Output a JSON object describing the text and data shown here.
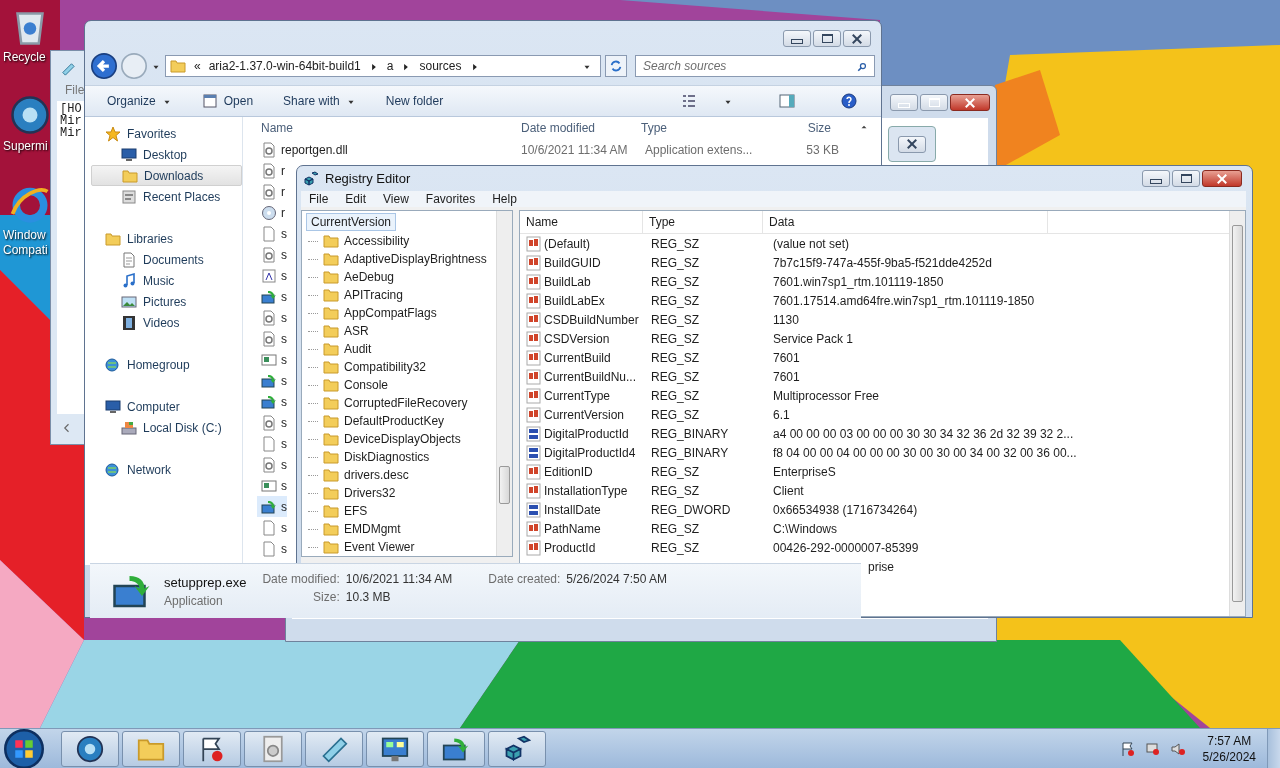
{
  "desktop_icons": [
    {
      "label": "Recycle"
    },
    {
      "label": "Supermi"
    },
    {
      "label": "Window\nCompati"
    }
  ],
  "notepad": {
    "menu": "File",
    "lines": [
      "[HO",
      "Mir",
      "Mir"
    ]
  },
  "explorer": {
    "path": [
      "aria2-1.37.0-win-64bit-build1",
      "a",
      "sources"
    ],
    "overflow": "«",
    "search": {
      "placeholder": "Search sources"
    },
    "toolbar": [
      {
        "label": "Organize",
        "kind": "menu"
      },
      {
        "label": "Open",
        "kind": "open"
      },
      {
        "label": "Share with",
        "kind": "menu"
      },
      {
        "label": "New folder",
        "kind": "plain"
      }
    ],
    "nav": [
      {
        "label": "Favorites",
        "selected": false,
        "children": [
          {
            "label": "Desktop",
            "selected": false
          },
          {
            "label": "Downloads",
            "selected": true
          },
          {
            "label": "Recent Places",
            "selected": false
          }
        ]
      },
      {
        "label": "Libraries",
        "selected": false,
        "children": [
          {
            "label": "Documents",
            "selected": false
          },
          {
            "label": "Music",
            "selected": false
          },
          {
            "label": "Pictures",
            "selected": false
          },
          {
            "label": "Videos",
            "selected": false
          }
        ]
      },
      {
        "label": "Homegroup",
        "selected": false
      },
      {
        "label": "Computer",
        "selected": false,
        "children": [
          {
            "label": "Local Disk (C:)",
            "selected": false
          }
        ]
      },
      {
        "label": "Network",
        "selected": false
      }
    ],
    "columns": [
      "Name",
      "Date modified",
      "Type",
      "Size"
    ],
    "files": [
      {
        "name": "reportgen.dll",
        "date": "10/6/2021 11:34 AM",
        "type": "Application extens...",
        "size": "53 KB",
        "kind": "dll",
        "selected": false
      },
      {
        "name": "r",
        "kind": "dll",
        "selected": false
      },
      {
        "name": "r",
        "kind": "dll",
        "selected": false
      },
      {
        "name": "r",
        "kind": "cd",
        "selected": false
      },
      {
        "name": "s",
        "kind": "blank",
        "selected": false
      },
      {
        "name": "s",
        "kind": "dll",
        "selected": false
      },
      {
        "name": "s",
        "kind": "font",
        "selected": false
      },
      {
        "name": "s",
        "kind": "setup",
        "selected": false
      },
      {
        "name": "s",
        "kind": "dll",
        "selected": false
      },
      {
        "name": "s",
        "kind": "dll",
        "selected": false
      },
      {
        "name": "s",
        "kind": "img",
        "selected": false
      },
      {
        "name": "s",
        "kind": "setup",
        "selected": false
      },
      {
        "name": "s",
        "kind": "setup",
        "selected": false
      },
      {
        "name": "s",
        "kind": "dll",
        "selected": false
      },
      {
        "name": "s",
        "kind": "blank",
        "selected": false
      },
      {
        "name": "s",
        "kind": "dll",
        "selected": false
      },
      {
        "name": "s",
        "kind": "img",
        "selected": false
      },
      {
        "name": "s",
        "kind": "setup",
        "selected": true
      },
      {
        "name": "s",
        "kind": "blank",
        "selected": false
      },
      {
        "name": "s",
        "kind": "blank",
        "selected": false
      }
    ],
    "details": {
      "name": "setupprep.exe",
      "type": "Application",
      "fields": [
        {
          "label": "Date modified:",
          "value": "10/6/2021 11:34 AM"
        },
        {
          "label": "Size:",
          "value": "10.3 MB"
        },
        {
          "label": "Date created:",
          "value": "5/26/2024 7:50 AM"
        }
      ]
    }
  },
  "registry": {
    "title": "Registry Editor",
    "menu": [
      "File",
      "Edit",
      "View",
      "Favorites",
      "Help"
    ],
    "tree": {
      "label": "CurrentVersion",
      "selected": true,
      "children": [
        "Accessibility",
        "AdaptiveDisplayBrightness",
        "AeDebug",
        "APITracing",
        "AppCompatFlags",
        "ASR",
        "Audit",
        "Compatibility32",
        "Console",
        "CorruptedFileRecovery",
        "DefaultProductKey",
        "DeviceDisplayObjects",
        "DiskDiagnostics",
        "drivers.desc",
        "Drivers32",
        "EFS",
        "EMDMgmt",
        "Event Viewer"
      ]
    },
    "columns": [
      "Name",
      "Type",
      "Data"
    ],
    "values": [
      {
        "kind": "string",
        "name": "(Default)",
        "type": "REG_SZ",
        "data": "(value not set)"
      },
      {
        "kind": "string",
        "name": "BuildGUID",
        "type": "REG_SZ",
        "data": "7b7c15f9-747a-455f-9ba5-f521dde4252d"
      },
      {
        "kind": "string",
        "name": "BuildLab",
        "type": "REG_SZ",
        "data": "7601.win7sp1_rtm.101119-1850"
      },
      {
        "kind": "string",
        "name": "BuildLabEx",
        "type": "REG_SZ",
        "data": "7601.17514.amd64fre.win7sp1_rtm.101119-1850"
      },
      {
        "kind": "string",
        "name": "CSDBuildNumber",
        "type": "REG_SZ",
        "data": "1130"
      },
      {
        "kind": "string",
        "name": "CSDVersion",
        "type": "REG_SZ",
        "data": "Service Pack 1"
      },
      {
        "kind": "string",
        "name": "CurrentBuild",
        "type": "REG_SZ",
        "data": "7601"
      },
      {
        "kind": "string",
        "name": "CurrentBuildNu...",
        "type": "REG_SZ",
        "data": "7601"
      },
      {
        "kind": "string",
        "name": "CurrentType",
        "type": "REG_SZ",
        "data": "Multiprocessor Free"
      },
      {
        "kind": "string",
        "name": "CurrentVersion",
        "type": "REG_SZ",
        "data": "6.1"
      },
      {
        "kind": "binary",
        "name": "DigitalProductId",
        "type": "REG_BINARY",
        "data": "a4 00 00 00 03 00 00 00 30 30 34 32 36 2d 32 39 32 2..."
      },
      {
        "kind": "binary",
        "name": "DigitalProductId4",
        "type": "REG_BINARY",
        "data": "f8 04 00 00 04 00 00 00 30 00 30 00 34 00 32 00 36 00..."
      },
      {
        "kind": "string",
        "name": "EditionID",
        "type": "REG_SZ",
        "data": "EnterpriseS"
      },
      {
        "kind": "string",
        "name": "InstallationType",
        "type": "REG_SZ",
        "data": "Client"
      },
      {
        "kind": "binary",
        "name": "InstallDate",
        "type": "REG_DWORD",
        "data": "0x66534938 (1716734264)"
      },
      {
        "kind": "string",
        "name": "PathName",
        "type": "REG_SZ",
        "data": "C:\\Windows"
      },
      {
        "kind": "string",
        "name": "ProductId",
        "type": "REG_SZ",
        "data": "00426-292-0000007-85399"
      },
      {
        "kind": "covered",
        "data": "prise"
      }
    ]
  },
  "taskbar": {
    "time": "7:57 AM",
    "date": "5/26/2024"
  }
}
